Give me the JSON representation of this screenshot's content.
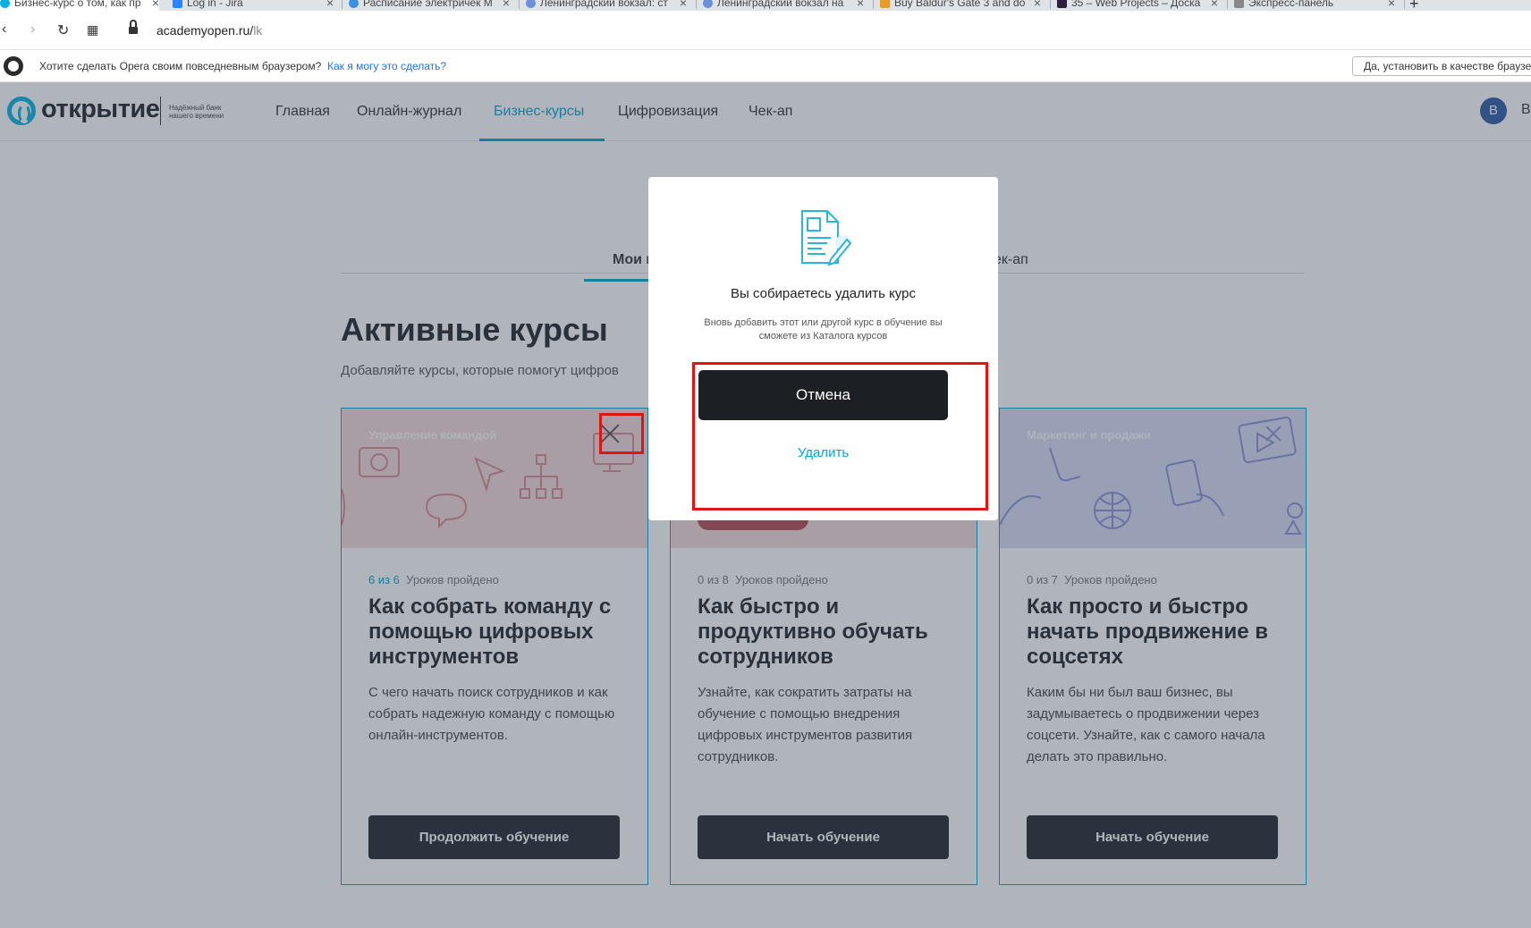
{
  "browser": {
    "tabs": [
      {
        "title": "Бизнес-курс о том, как пр",
        "active": true,
        "favicon_color": "#00b2e3"
      },
      {
        "title": "Log in - Jira",
        "active": false,
        "favicon_color": "#2684ff"
      },
      {
        "title": "Расписание электричек М",
        "active": false,
        "favicon_color": "#3d8fe0"
      },
      {
        "title": "Ленинградский вокзал: ст",
        "active": false,
        "favicon_color": "#6b8fd8"
      },
      {
        "title": "Ленинградский вокзал на",
        "active": false,
        "favicon_color": "#6b8fd8"
      },
      {
        "title": "Buy Baldur's Gate 3 and do",
        "active": false,
        "favicon_color": "#e89a2c"
      },
      {
        "title": "35 – Web Projects – Доска",
        "active": false,
        "favicon_color": "#2a1f3d"
      },
      {
        "title": "Экспресс-панель",
        "active": false,
        "favicon_color": "#888888"
      }
    ],
    "new_tab": "+",
    "url_host": "academyopen.ru/",
    "url_path": "lk",
    "opera_prompt": "Хотите сделать Opera своим повседневным браузером?",
    "opera_link": "Как я могу это сделать?",
    "opera_button": "Да, установить в качестве браузер"
  },
  "site": {
    "logo_text": "открытие",
    "logo_tagline": "Надёжный банк нашего времени",
    "menu": [
      {
        "label": "Главная",
        "active": false
      },
      {
        "label": "Онлайн-журнал",
        "active": false
      },
      {
        "label": "Бизнес-курсы",
        "active": true
      },
      {
        "label": "Цифровизация",
        "active": false
      },
      {
        "label": "Чек-ап",
        "active": false
      }
    ],
    "avatar_letter": "В",
    "user_name": "В"
  },
  "main": {
    "course_tabs": [
      {
        "label": "Мои к",
        "active": true
      },
      {
        "label": "ек-ап",
        "active": false
      }
    ],
    "section_title": "Активные курсы",
    "section_subtitle": "Добавляйте курсы, которые помогут цифров"
  },
  "cards": [
    {
      "category": "Управление командой",
      "banner_color": "#f4d9da",
      "progress_done": "6 из 6",
      "progress_label": "Уроков пройдено",
      "title": "Как собрать команду с помощью цифровых инструментов",
      "description": "С чего начать поиск сотрудников и как собрать надежную команду с помощью онлайн-инструментов.",
      "button": "Продолжить обучение"
    },
    {
      "category": "",
      "banner_color": "#f4d9da",
      "progress_done": "0 из 8",
      "progress_label": "Уроков пройдено",
      "title": "Как быстро и продуктивно обучать сотрудников",
      "description": "Узнайте, как сократить затраты на обучение с помощью внедрения цифровых инструментов развития сотрудников.",
      "button": "Начать обучение"
    },
    {
      "category": "Маркетинг и продажи",
      "banner_color": "#d9dcf5",
      "progress_done": "0 из 7",
      "progress_label": "Уроков пройдено",
      "title": "Как просто и быстро начать продвижение в соцсетях",
      "description": "Каким бы ни был ваш бизнес, вы задумываетесь о продвижении через соцсети. Узнайте, как с самого начала делать это правильно.",
      "button": "Начать обучение"
    }
  ],
  "modal": {
    "title": "Вы собираетесь удалить курс",
    "text": "Вновь добавить этот или другой курс в обучение вы сможете из Каталога курсов",
    "cancel": "Отмена",
    "delete": "Удалить"
  },
  "colors": {
    "accent": "#00a6d8",
    "highlight": "#e11414",
    "overlay": "rgba(58,70,88,0.40)"
  }
}
